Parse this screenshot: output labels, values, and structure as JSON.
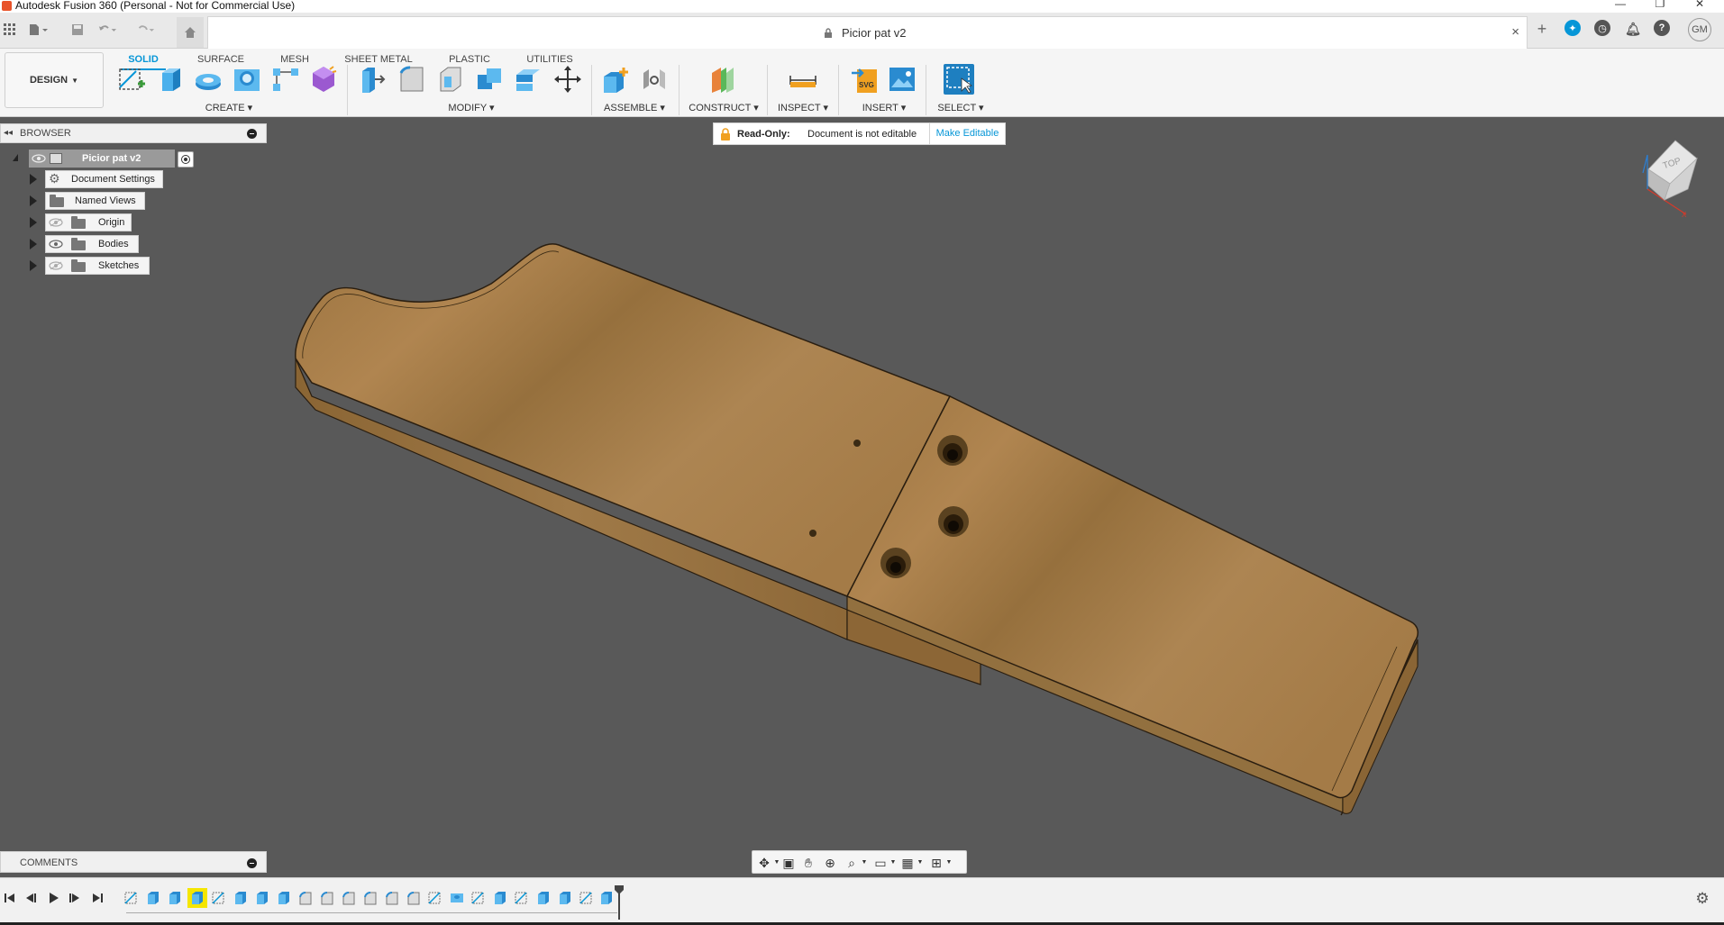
{
  "window": {
    "title": "Autodesk Fusion 360 (Personal - Not for Commercial Use)",
    "minimize": "—",
    "maximize": "❐",
    "close": "✕"
  },
  "document_tab": {
    "name": "Picior pat v2",
    "close": "×"
  },
  "user_initials": "GM",
  "toolbar": {
    "workspace": "DESIGN",
    "tabs": [
      "SOLID",
      "SURFACE",
      "MESH",
      "SHEET METAL",
      "PLASTIC",
      "UTILITIES"
    ],
    "active_tab": "SOLID",
    "groups": {
      "create": "CREATE",
      "modify": "MODIFY",
      "assemble": "ASSEMBLE",
      "construct": "CONSTRUCT",
      "inspect": "INSPECT",
      "insert": "INSERT",
      "select": "SELECT"
    }
  },
  "browser": {
    "header": "BROWSER",
    "root": "Picior pat v2",
    "items": [
      {
        "label": "Document Settings",
        "icon": "gear-icon"
      },
      {
        "label": "Named Views",
        "icon": "folder-icon"
      },
      {
        "label": "Origin",
        "icon": "folder-icon",
        "visible": false
      },
      {
        "label": "Bodies",
        "icon": "folder-icon",
        "visible": true
      },
      {
        "label": "Sketches",
        "icon": "folder-icon",
        "visible": false
      }
    ]
  },
  "readonly_banner": {
    "label": "Read-Only:",
    "message": "Document is not editable",
    "action": "Make Editable"
  },
  "comments": {
    "header": "COMMENTS"
  },
  "viewcube": {
    "face": "TOP"
  },
  "colors": {
    "accent": "#0696d7",
    "viewport": "#595959",
    "wood_light": "#a77e4b",
    "wood_dark": "#7a5a30"
  }
}
